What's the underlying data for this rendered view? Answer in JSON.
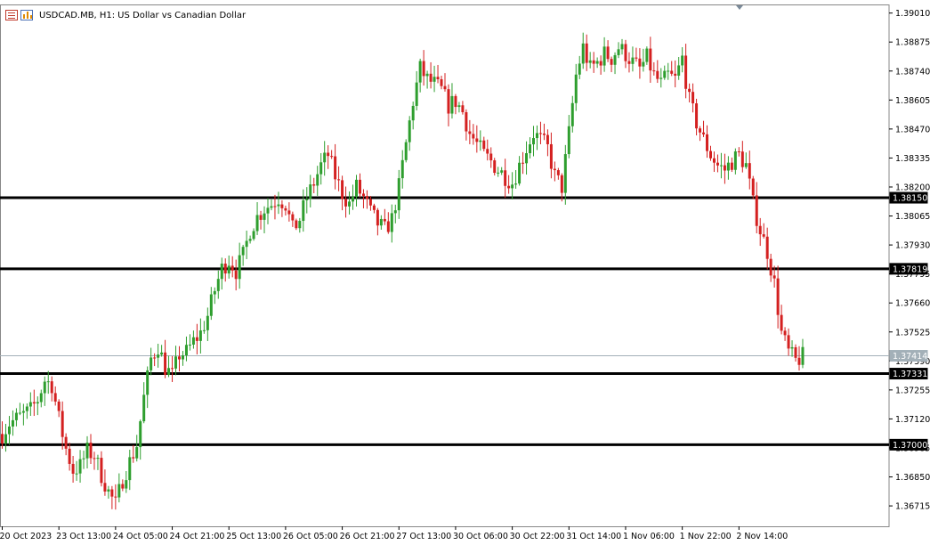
{
  "header": {
    "symbol_label": "USDCAD.MB, H1:",
    "description": "US Dollar vs Canadian Dollar",
    "icons": [
      "order-list-icon",
      "chart-bars-icon"
    ]
  },
  "colors": {
    "bull": "#2e9e2e",
    "bear": "#d42020",
    "level_line": "#000000",
    "bid_line": "#a3b0b8",
    "bid_label_bg": "#a3b0b8",
    "frame": "#888888"
  },
  "chart_data": {
    "type": "candlestick",
    "timeframe": "H1",
    "ylim": [
      1.3662,
      1.3905
    ],
    "y_ticks": [
      "1.39010",
      "1.38875",
      "1.38740",
      "1.38605",
      "1.38470",
      "1.38335",
      "1.38200",
      "1.38065",
      "1.37930",
      "1.37795",
      "1.37660",
      "1.37525",
      "1.37390",
      "1.37255",
      "1.37120",
      "1.36985",
      "1.36850",
      "1.36715"
    ],
    "x_ticks": [
      "20 Oct 2023",
      "23 Oct 13:00",
      "24 Oct 05:00",
      "24 Oct 21:00",
      "25 Oct 13:00",
      "26 Oct 05:00",
      "26 Oct 21:00",
      "27 Oct 13:00",
      "30 Oct 06:00",
      "30 Oct 22:00",
      "31 Oct 14:00",
      "1 Nov 06:00",
      "1 Nov 22:00",
      "2 Nov 14:00"
    ],
    "x_tick_slot": [
      0,
      16,
      32,
      48,
      64,
      80,
      96,
      112,
      128,
      144,
      160,
      176,
      192,
      208
    ],
    "levels": [
      {
        "value": 1.3815,
        "label": "1.38150"
      },
      {
        "value": 1.37819,
        "label": "1.37819"
      },
      {
        "value": 1.37331,
        "label": "1.37331"
      },
      {
        "value": 1.37,
        "label": "1.37000"
      }
    ],
    "bid": {
      "value": 1.37414,
      "label": "1.37414"
    },
    "trend_anchors": [
      [
        0,
        1.3705
      ],
      [
        2,
        1.371
      ],
      [
        5,
        1.3713
      ],
      [
        8,
        1.3716
      ],
      [
        10,
        1.3721
      ],
      [
        12,
        1.373
      ],
      [
        14,
        1.3728
      ],
      [
        16,
        1.3712
      ],
      [
        18,
        1.3698
      ],
      [
        20,
        1.3688
      ],
      [
        22,
        1.369
      ],
      [
        24,
        1.3697
      ],
      [
        26,
        1.3695
      ],
      [
        28,
        1.3686
      ],
      [
        30,
        1.3678
      ],
      [
        32,
        1.3672
      ],
      [
        34,
        1.3684
      ],
      [
        36,
        1.3692
      ],
      [
        38,
        1.37
      ],
      [
        40,
        1.3722
      ],
      [
        42,
        1.374
      ],
      [
        44,
        1.3746
      ],
      [
        46,
        1.3736
      ],
      [
        48,
        1.3732
      ],
      [
        50,
        1.3742
      ],
      [
        52,
        1.3743
      ],
      [
        54,
        1.3748
      ],
      [
        56,
        1.3752
      ],
      [
        58,
        1.376
      ],
      [
        60,
        1.3772
      ],
      [
        62,
        1.3782
      ],
      [
        64,
        1.3786
      ],
      [
        66,
        1.3781
      ],
      [
        68,
        1.3788
      ],
      [
        70,
        1.38
      ],
      [
        72,
        1.3806
      ],
      [
        74,
        1.381
      ],
      [
        76,
        1.3812
      ],
      [
        78,
        1.3815
      ],
      [
        80,
        1.3812
      ],
      [
        82,
        1.38
      ],
      [
        84,
        1.3805
      ],
      [
        86,
        1.3815
      ],
      [
        88,
        1.3822
      ],
      [
        90,
        1.383
      ],
      [
        92,
        1.3835
      ],
      [
        94,
        1.3825
      ],
      [
        96,
        1.3817
      ],
      [
        98,
        1.3812
      ],
      [
        100,
        1.382
      ],
      [
        102,
        1.3815
      ],
      [
        104,
        1.3808
      ],
      [
        106,
        1.3803
      ],
      [
        108,
        1.38
      ],
      [
        110,
        1.3805
      ],
      [
        112,
        1.382
      ],
      [
        114,
        1.384
      ],
      [
        116,
        1.386
      ],
      [
        118,
        1.3875
      ],
      [
        120,
        1.387
      ],
      [
        122,
        1.3868
      ],
      [
        124,
        1.3865
      ],
      [
        126,
        1.3858
      ],
      [
        128,
        1.386
      ],
      [
        130,
        1.3855
      ],
      [
        132,
        1.3845
      ],
      [
        134,
        1.384
      ],
      [
        136,
        1.3835
      ],
      [
        138,
        1.3832
      ],
      [
        140,
        1.3828
      ],
      [
        142,
        1.3825
      ],
      [
        144,
        1.3822
      ],
      [
        146,
        1.383
      ],
      [
        148,
        1.3838
      ],
      [
        150,
        1.3845
      ],
      [
        152,
        1.3842
      ],
      [
        154,
        1.3838
      ],
      [
        156,
        1.3825
      ],
      [
        158,
        1.382
      ],
      [
        160,
        1.3845
      ],
      [
        162,
        1.3872
      ],
      [
        164,
        1.3885
      ],
      [
        166,
        1.3875
      ],
      [
        168,
        1.3878
      ],
      [
        170,
        1.3882
      ],
      [
        172,
        1.388
      ],
      [
        174,
        1.3885
      ],
      [
        176,
        1.3882
      ],
      [
        178,
        1.3878
      ],
      [
        180,
        1.3875
      ],
      [
        182,
        1.388
      ],
      [
        184,
        1.3872
      ],
      [
        186,
        1.3868
      ],
      [
        188,
        1.3872
      ],
      [
        190,
        1.387
      ],
      [
        192,
        1.388
      ],
      [
        194,
        1.386
      ],
      [
        196,
        1.385
      ],
      [
        198,
        1.3842
      ],
      [
        200,
        1.3835
      ],
      [
        202,
        1.383
      ],
      [
        204,
        1.3828
      ],
      [
        206,
        1.3832
      ],
      [
        208,
        1.3835
      ],
      [
        210,
        1.383
      ],
      [
        212,
        1.3812
      ],
      [
        214,
        1.38
      ],
      [
        216,
        1.379
      ],
      [
        218,
        1.3775
      ],
      [
        220,
        1.3752
      ],
      [
        222,
        1.3743
      ],
      [
        224,
        1.3739
      ],
      [
        226,
        1.3741
      ]
    ]
  }
}
